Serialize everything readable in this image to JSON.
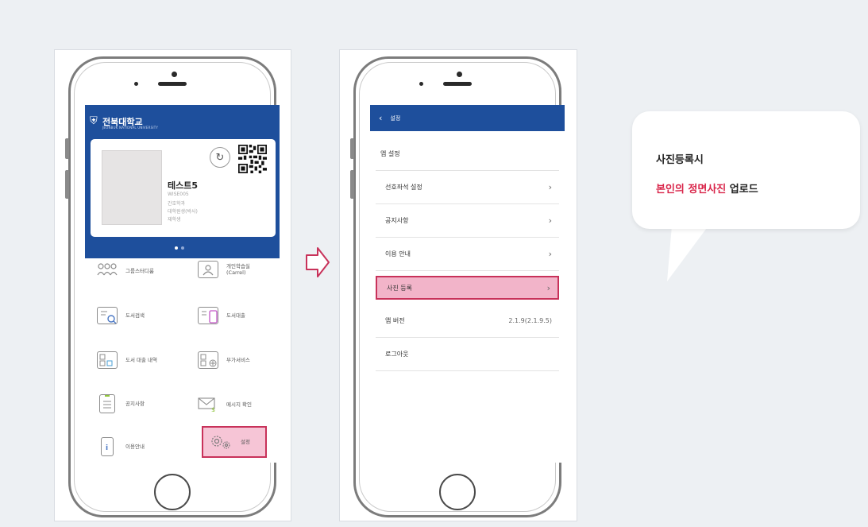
{
  "left_phone": {
    "university_logo": "전북대학교",
    "university_subtitle": "JEONBUK NATIONAL UNIVERSITY",
    "card": {
      "name": "테스트5",
      "id": "WISE005",
      "department": "간호학과",
      "program": "대학원생(박사)",
      "status": "재학생"
    },
    "menu": [
      {
        "label": "그룹스터디룸",
        "icon": "group-study-icon"
      },
      {
        "label": "개인학습실\n(Carrel)",
        "icon": "carrel-icon"
      },
      {
        "label": "도서검색",
        "icon": "book-search-icon"
      },
      {
        "label": "도서대출",
        "icon": "book-loan-icon"
      },
      {
        "label": "도서 대출 내역",
        "icon": "loan-history-icon"
      },
      {
        "label": "부가서비스",
        "icon": "additional-service-icon"
      },
      {
        "label": "공지사항",
        "icon": "notice-icon"
      },
      {
        "label": "메시지 확인",
        "icon": "message-icon"
      },
      {
        "label": "이용안내",
        "icon": "info-icon"
      },
      {
        "label": "설정",
        "icon": "gear-icon"
      }
    ]
  },
  "right_phone": {
    "nav_title": "설정",
    "section_title": "앱 설정",
    "rows": [
      {
        "label": "선호좌석 설정",
        "value": ""
      },
      {
        "label": "공지사항",
        "value": ""
      },
      {
        "label": "이용 안내",
        "value": ""
      },
      {
        "label": "사진 등록",
        "value": ""
      },
      {
        "label": "앱 버전",
        "value": "2.1.9(2.1.9.5)"
      },
      {
        "label": "로그아웃",
        "value": ""
      }
    ]
  },
  "bubble": {
    "title": "사진등록시",
    "line_highlight": "본인의 정면사진",
    "line_rest": " 업로드"
  },
  "colors": {
    "brand_blue": "#1e4f9c",
    "highlight_pink": "#f2b4c9",
    "highlight_border": "#c8325a",
    "accent_red": "#d9254a"
  }
}
